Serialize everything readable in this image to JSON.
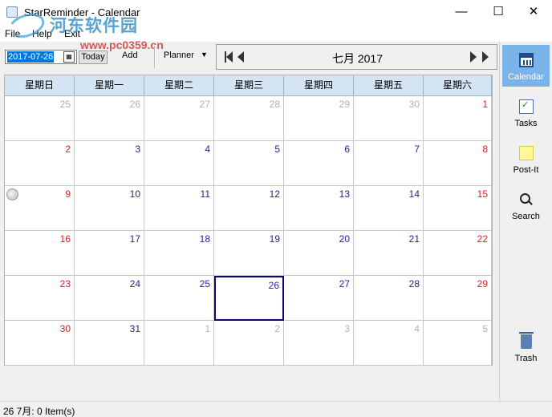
{
  "window": {
    "title": "StarReminder - Calendar"
  },
  "watermark": {
    "text": "河东软件园",
    "url": "www.pc0359.cn"
  },
  "menu": {
    "file": "File",
    "help": "Help",
    "exit": "Exit"
  },
  "toolbar": {
    "date_value": "2017-07-26",
    "today_label": "Today",
    "add_label": "Add",
    "view_select": "Planner",
    "month_title": "七月 2017"
  },
  "weekdays": [
    "星期日",
    "星期一",
    "星期二",
    "星期三",
    "星期四",
    "星期五",
    "星期六"
  ],
  "weeks": [
    [
      "25",
      "26",
      "27",
      "28",
      "29",
      "30",
      "1"
    ],
    [
      "2",
      "3",
      "4",
      "5",
      "6",
      "7",
      "8"
    ],
    [
      "9",
      "10",
      "11",
      "12",
      "13",
      "14",
      "15"
    ],
    [
      "16",
      "17",
      "18",
      "19",
      "20",
      "21",
      "22"
    ],
    [
      "23",
      "24",
      "25",
      "26",
      "27",
      "28",
      "29"
    ],
    [
      "30",
      "31",
      "1",
      "2",
      "3",
      "4",
      "5"
    ]
  ],
  "sidebar": {
    "calendar": "Calendar",
    "tasks": "Tasks",
    "postit": "Post-It",
    "search": "Search",
    "trash": "Trash"
  },
  "status": {
    "text": "26 7月: 0 Item(s)"
  },
  "colors": {
    "accent": "#7ab4eb",
    "weekend": "#d2232a",
    "weekday": "#1f1f9c",
    "header": "#d4e4f3"
  }
}
